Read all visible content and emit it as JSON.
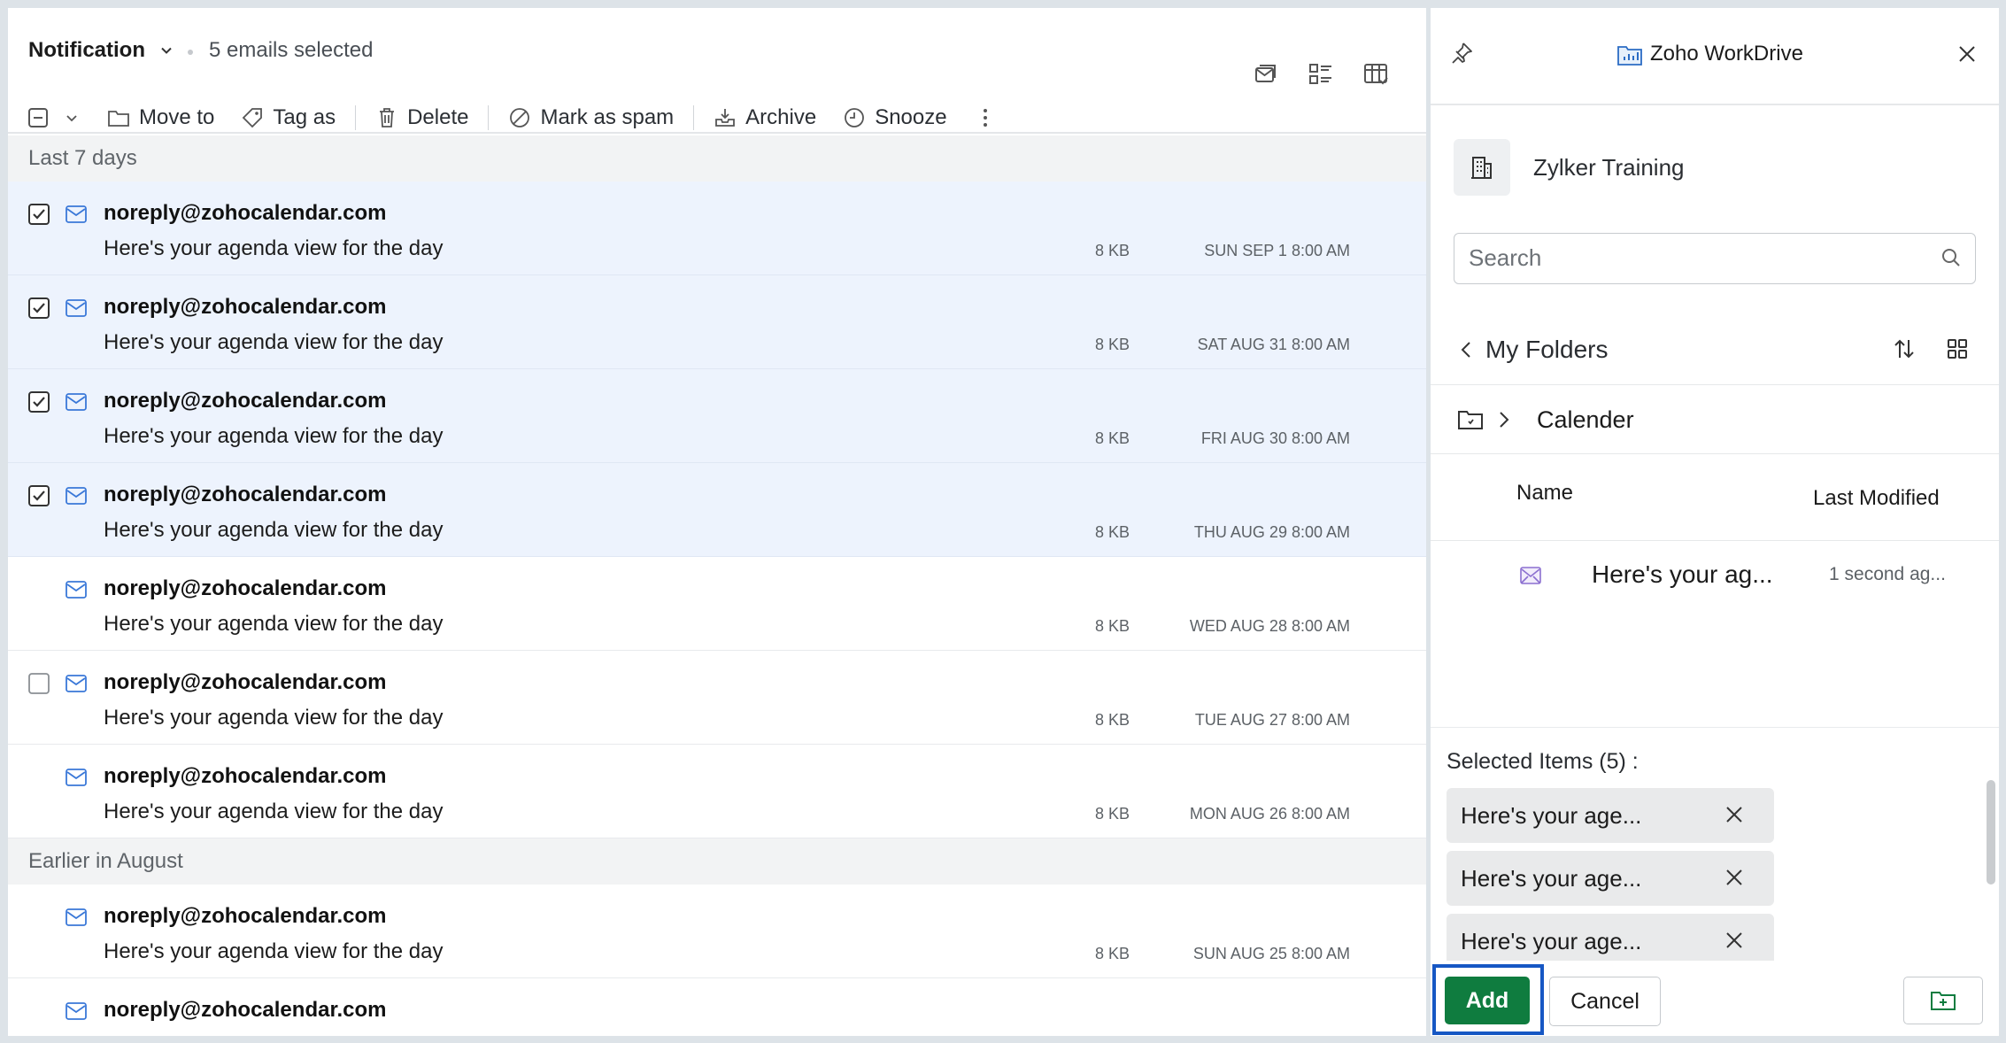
{
  "mail": {
    "folder_title": "Notification",
    "selection_text": "5 emails selected",
    "toolbar": {
      "move_to": "Move to",
      "tag_as": "Tag as",
      "delete": "Delete",
      "mark_spam": "Mark as spam",
      "archive": "Archive",
      "snooze": "Snooze"
    },
    "groups": [
      {
        "label": "Last 7 days",
        "rows": [
          {
            "sender": "noreply@zohocalendar.com",
            "subject": "Here's your agenda view for the day",
            "size": "8 KB",
            "date": "SUN SEP 1 8:00 AM",
            "checked": true
          },
          {
            "sender": "noreply@zohocalendar.com",
            "subject": "Here's your agenda view for the day",
            "size": "8 KB",
            "date": "SAT AUG 31 8:00 AM",
            "checked": true
          },
          {
            "sender": "noreply@zohocalendar.com",
            "subject": "Here's your agenda view for the day",
            "size": "8 KB",
            "date": "FRI AUG 30 8:00 AM",
            "checked": true
          },
          {
            "sender": "noreply@zohocalendar.com",
            "subject": "Here's your agenda view for the day",
            "size": "8 KB",
            "date": "THU AUG 29 8:00 AM",
            "checked": true
          },
          {
            "sender": "noreply@zohocalendar.com",
            "subject": "Here's your agenda view for the day",
            "size": "8 KB",
            "date": "WED AUG 28 8:00 AM",
            "checked": false
          },
          {
            "sender": "noreply@zohocalendar.com",
            "subject": "Here's your agenda view for the day",
            "size": "8 KB",
            "date": "TUE AUG 27 8:00 AM",
            "checked": false
          },
          {
            "sender": "noreply@zohocalendar.com",
            "subject": "Here's your agenda view for the day",
            "size": "8 KB",
            "date": "MON AUG 26 8:00 AM",
            "checked": false
          }
        ]
      },
      {
        "label": "Earlier in August",
        "rows": [
          {
            "sender": "noreply@zohocalendar.com",
            "subject": "Here's your agenda view for the day",
            "size": "8 KB",
            "date": "SUN AUG 25 8:00 AM",
            "checked": false
          },
          {
            "sender": "noreply@zohocalendar.com",
            "subject": "",
            "size": "",
            "date": "",
            "checked": false
          }
        ]
      }
    ]
  },
  "workdrive": {
    "brand": "Zoho WorkDrive",
    "team_name": "Zylker Training",
    "search_placeholder": "Search",
    "my_folders": "My Folders",
    "current_folder": "Calender",
    "columns": {
      "name": "Name",
      "last_modified": "Last Modified"
    },
    "files": [
      {
        "name": "Here's your ag...",
        "modified": "1 second ag..."
      }
    ],
    "selected_title": "Selected Items (5) :",
    "selected_items": [
      "Here's your age...",
      "Here's your age...",
      "Here's your age..."
    ],
    "add_label": "Add",
    "cancel_label": "Cancel"
  },
  "colors": {
    "accent_green": "#0f7c3f",
    "focus_blue": "#1657c4",
    "selected_row": "#edf3fd",
    "mail_icon_blue": "#3a78d8"
  }
}
